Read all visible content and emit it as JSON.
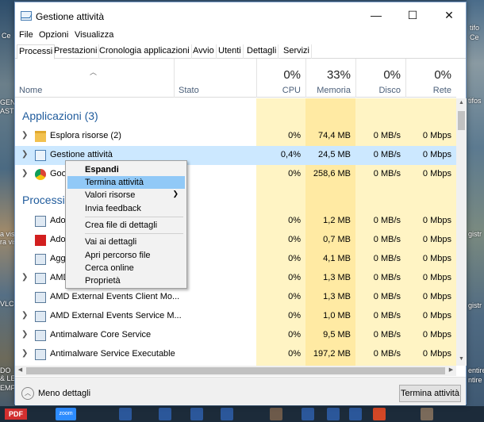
{
  "window": {
    "title": "Gestione attività",
    "minimize": "—",
    "maximize": "☐",
    "close": "✕"
  },
  "menu": [
    "File",
    "Opzioni",
    "Visualizza"
  ],
  "tabs": [
    "Processi",
    "Prestazioni",
    "Cronologia applicazioni",
    "Avvio",
    "Utenti",
    "Dettagli",
    "Servizi"
  ],
  "columns": {
    "name": "Nome",
    "status": "Stato",
    "cpu": {
      "pct": "0%",
      "label": "CPU"
    },
    "memory": {
      "pct": "33%",
      "label": "Memoria"
    },
    "disk": {
      "pct": "0%",
      "label": "Disco"
    },
    "network": {
      "pct": "0%",
      "label": "Rete"
    }
  },
  "groups": {
    "apps": "Applicazioni (3)",
    "processes": "Processi"
  },
  "rows": [
    {
      "name": "Esplora risorse (2)",
      "icon": "folder-icon",
      "cpu": "0%",
      "mem": "74,4 MB",
      "disk": "0 MB/s",
      "net": "0 Mbps"
    },
    {
      "name": "Gestione attività",
      "icon": "task-manager-icon",
      "cpu": "0,4%",
      "mem": "24,5 MB",
      "disk": "0 MB/s",
      "net": "0 Mbps"
    },
    {
      "name": "Goo",
      "icon": "chrome-icon",
      "cpu": "0%",
      "mem": "258,6 MB",
      "disk": "0 MB/s",
      "net": "0 Mbps"
    },
    {
      "name": "Ado",
      "icon": "app-icon",
      "cpu": "0%",
      "mem": "1,2 MB",
      "disk": "0 MB/s",
      "net": "0 Mbps"
    },
    {
      "name": "Ado",
      "icon": "adobe-icon",
      "cpu": "0%",
      "mem": "0,7 MB",
      "disk": "0 MB/s",
      "net": "0 Mbps"
    },
    {
      "name": "Agg",
      "icon": "app-icon",
      "cpu": "0%",
      "mem": "4,1 MB",
      "disk": "0 MB/s",
      "net": "0 Mbps"
    },
    {
      "name": "AMD",
      "icon": "app-icon",
      "cpu": "0%",
      "mem": "1,3 MB",
      "disk": "0 MB/s",
      "net": "0 Mbps"
    },
    {
      "name": "AMD External Events Client Mo...",
      "icon": "app-icon",
      "cpu": "0%",
      "mem": "1,3 MB",
      "disk": "0 MB/s",
      "net": "0 Mbps"
    },
    {
      "name": "AMD External Events Service M...",
      "icon": "app-icon",
      "cpu": "0%",
      "mem": "1,0 MB",
      "disk": "0 MB/s",
      "net": "0 Mbps"
    },
    {
      "name": "Antimalware Core Service",
      "icon": "app-icon",
      "cpu": "0%",
      "mem": "9,5 MB",
      "disk": "0 MB/s",
      "net": "0 Mbps"
    },
    {
      "name": "Antimalware Service Executable",
      "icon": "app-icon",
      "cpu": "0%",
      "mem": "197,2 MB",
      "disk": "0 MB/s",
      "net": "0 Mbps"
    }
  ],
  "context_menu": [
    "Espandi",
    "Termina attività",
    "Valori risorse",
    "Invia feedback",
    "Crea file di dettagli",
    "Vai ai dettagli",
    "Apri percorso file",
    "Cerca online",
    "Proprietà"
  ],
  "footer": {
    "less_details": "Meno dettagli",
    "end_task": "Termina attività"
  },
  "desktop": {
    "left_labels": [
      "Ce",
      "GEN",
      "AST",
      "a vis",
      "ra vis",
      "VLC",
      "DO",
      "& LE",
      "EMP"
    ],
    "right_labels": [
      "tifo",
      "Ce",
      "tifos",
      "gistr",
      "gistr",
      "entire",
      "ntire"
    ],
    "taskbar_pdf": "PDF",
    "taskbar_zoom": "zoom"
  },
  "colors": {
    "accent": "#1f5b9c",
    "selected_row": "#cce8ff",
    "heat_light": "#fff4c4",
    "heat_mid": "#ffeaa3",
    "menu_hover": "#91c9f7"
  }
}
